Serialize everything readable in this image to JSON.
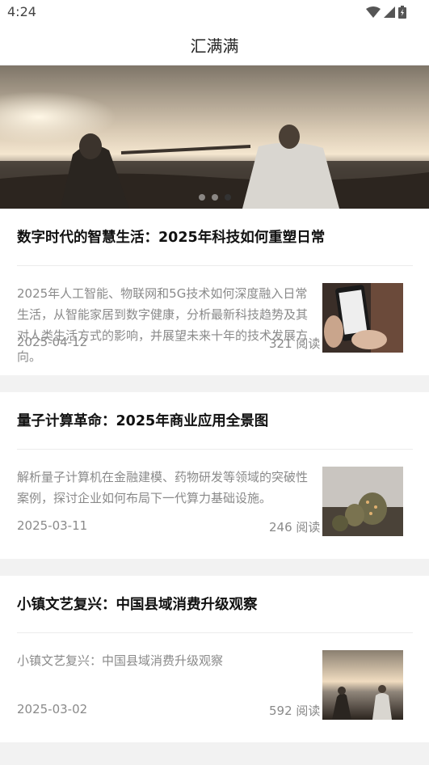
{
  "status_bar": {
    "time": "4:24"
  },
  "app": {
    "title": "汇满满"
  },
  "banner": {
    "slides": 3,
    "active_slide": 3
  },
  "articles": [
    {
      "title": "数字时代的智慧生活：2025年科技如何重塑日常",
      "summary": "2025年人工智能、物联网和5G技术如何深度融入日常生活，从智能家居到数字健康，分析最新科技趋势及其对人类生活方式的影响，并展望未来十年的技术发展方向。",
      "date": "2025-04-12",
      "views": "321 阅读"
    },
    {
      "title": "量子计算革命：2025年商业应用全景图",
      "summary": "解析量子计算机在金融建模、药物研发等领域的突破性案例，探讨企业如何布局下一代算力基础设施。",
      "date": "2025-03-11",
      "views": "246 阅读"
    },
    {
      "title": "小镇文艺复兴：中国县域消费升级观察",
      "summary": "小镇文艺复兴：中国县域消费升级观察",
      "date": "2025-03-02",
      "views": "592 阅读"
    }
  ]
}
